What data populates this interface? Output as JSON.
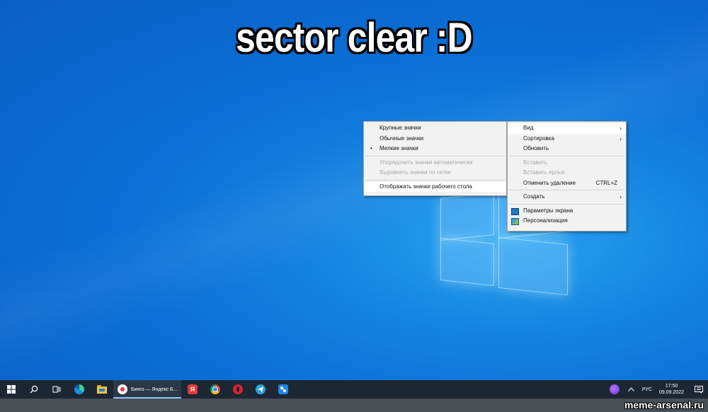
{
  "caption": "sector clear :D",
  "view_submenu": {
    "items": [
      {
        "label": "Крупные значки",
        "state": "enabled"
      },
      {
        "label": "Обычные значки",
        "state": "enabled"
      },
      {
        "label": "Мелкие значки",
        "state": "enabled",
        "bullet": "•"
      },
      {
        "label": "Упорядочить значки автоматически",
        "state": "disabled"
      },
      {
        "label": "Выровнять значки по сетке",
        "state": "disabled"
      },
      {
        "label": "Отображать значки рабочего стола",
        "state": "enabled"
      }
    ]
  },
  "context_menu": {
    "items": [
      {
        "label": "Вид",
        "arrow": "›"
      },
      {
        "label": "Сортировка",
        "arrow": "›"
      },
      {
        "label": "Обновить"
      },
      {
        "label": "Вставить",
        "state": "disabled"
      },
      {
        "label": "Вставить ярлык",
        "state": "disabled"
      },
      {
        "label": "Отменить удаление",
        "shortcut": "CTRL+Z"
      },
      {
        "label": "Создать",
        "arrow": "›"
      },
      {
        "label": "Параметры экрана",
        "icon": "display-settings-icon"
      },
      {
        "label": "Персонализация",
        "icon": "personalization-icon"
      }
    ]
  },
  "taskbar": {
    "active_task_label": "Бинго — Яндекс Б...",
    "language": "РУС",
    "time": "17:50",
    "date": "09.09.2022",
    "pinned_icons": [
      "windows-start-icon",
      "search-icon",
      "task-view-icon",
      "edge-icon",
      "file-explorer-icon",
      "yandex-browser-icon",
      "yandex-icon",
      "chrome-icon",
      "opera-icon",
      "telegram-icon",
      "app-icon"
    ],
    "tray_icons": [
      "alice-icon",
      "chevron-up-icon",
      "notifications-icon"
    ]
  },
  "watermark": "meme-arsenal.ru",
  "colors": {
    "desktop_blue": "#0b6fd6",
    "taskbar_bg": "#1d2633",
    "menu_bg": "#f2f2f2",
    "disabled_text": "#a8a8a8"
  }
}
